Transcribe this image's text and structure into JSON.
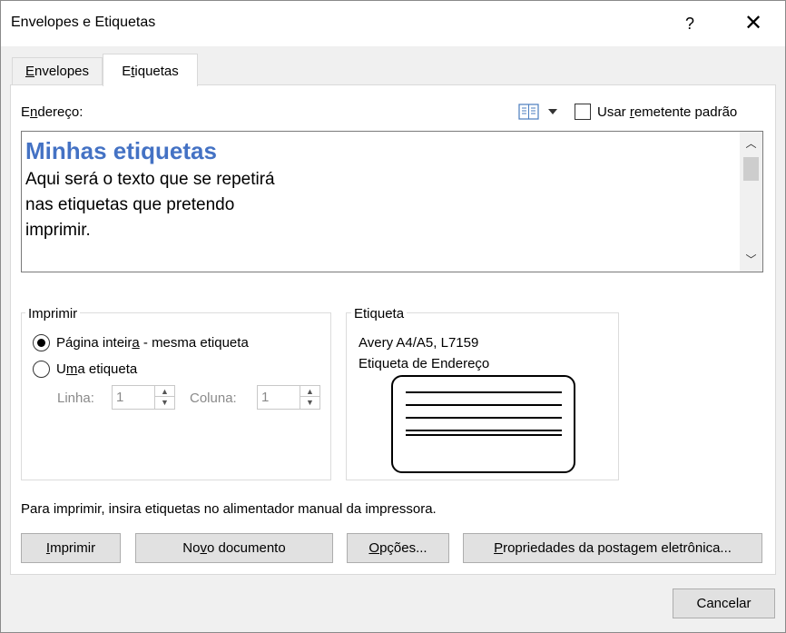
{
  "window": {
    "title": "Envelopes e Etiquetas",
    "help_glyph": "?",
    "close_glyph": "✕"
  },
  "tabs": [
    {
      "label_pre": "",
      "label_key": "E",
      "label_post": "nvelopes",
      "selected": false
    },
    {
      "label_pre": "E",
      "label_key": "t",
      "label_post": "iquetas",
      "selected": true
    }
  ],
  "address": {
    "label_key": "n",
    "label_pre": "E",
    "label_post": "dereço:",
    "use_default_label_pre": "Usar ",
    "use_default_label_key": "r",
    "use_default_label_post": "emetente padrão",
    "use_default_checked": false,
    "title": "Minhas etiquetas",
    "lines": [
      "Aqui será o texto que se repetirá",
      "nas etiquetas que pretendo",
      "imprimir."
    ],
    "title_color": "#4472c4"
  },
  "print_group": {
    "legend": "Imprimir",
    "full_page_pre": "Página inteir",
    "full_page_key": "a",
    "full_page_post": " - mesma etiqueta",
    "single_pre": "U",
    "single_key": "m",
    "single_post": "a etiqueta",
    "selected": "full_page",
    "row_label": "Linha:",
    "row_value": "1",
    "col_label": "Coluna:",
    "col_value": "1"
  },
  "label_group": {
    "legend": "Etiqueta",
    "product": "Avery A4/A5, L7159",
    "type": "Etiqueta de Endereço"
  },
  "info": "Para imprimir, insira etiquetas no alimentador manual da impressora.",
  "buttons": {
    "print_key": "I",
    "print_post": "mprimir",
    "new_doc_pre": "No",
    "new_doc_key": "v",
    "new_doc_post": "o documento",
    "options_key": "O",
    "options_post": "pções...",
    "postage_key": "P",
    "postage_post": "ropriedades da postagem eletrônica...",
    "cancel": "Cancelar"
  }
}
